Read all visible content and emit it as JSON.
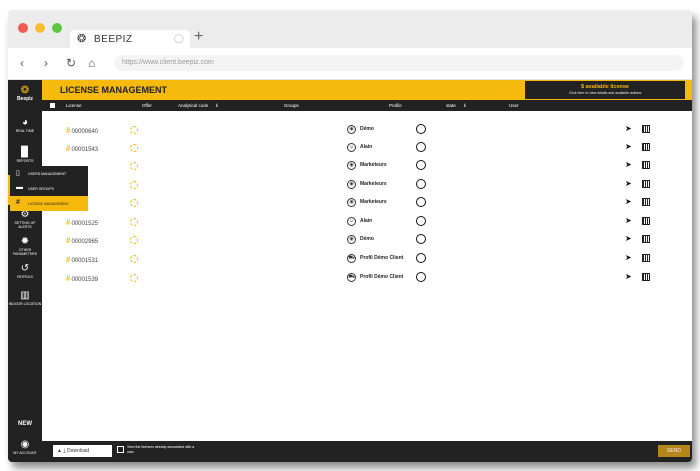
{
  "browser": {
    "tab_title": "BEEPIZ",
    "url": "https://www.client.beepiz.com"
  },
  "brand": {
    "name": "Beepiz"
  },
  "sidebar": {
    "items": [
      {
        "label": "Real time",
        "icon": "pie-chart-icon"
      },
      {
        "label": "Reports",
        "icon": "document-icon"
      },
      {
        "label": "Apps management",
        "icon": "phone-icon"
      },
      {
        "label": "Setting up alerts",
        "icon": "gears-icon"
      },
      {
        "label": "Other parameters",
        "icon": "gear-icon"
      },
      {
        "label": "Patrols",
        "icon": "patrol-icon"
      },
      {
        "label": "Indoor location",
        "icon": "building-icon"
      }
    ],
    "new_label": "NEW",
    "account_label": "MY ACCOUNT"
  },
  "submenu": {
    "items": [
      {
        "label": "Users management",
        "icon": "phone-icon"
      },
      {
        "label": "User groups",
        "icon": "folder-icon"
      },
      {
        "label": "License management",
        "icon": "hash-icon"
      }
    ]
  },
  "page": {
    "title": "LICENSE MANAGEMENT",
    "available_license": "$ available license",
    "available_hint": "Click here to view details and available actions"
  },
  "table": {
    "columns": [
      "License",
      "Offer",
      "Analytical code",
      "Groups",
      "Profile",
      "state",
      "User"
    ],
    "rows": [
      {
        "license": "00000640",
        "profile": "Démo",
        "profile_icon": "radio-icon"
      },
      {
        "license": "00001543",
        "profile": "Alain",
        "profile_icon": "user-icon"
      },
      {
        "license": "",
        "profile": "Marketeurs",
        "profile_icon": "radio-icon"
      },
      {
        "license": "",
        "profile": "Marketeurs",
        "profile_icon": "radio-icon"
      },
      {
        "license": "",
        "profile": "Marketeurs",
        "profile_icon": "radio-icon"
      },
      {
        "license": "00001525",
        "profile": "Alain",
        "profile_icon": "user-icon"
      },
      {
        "license": "00002965",
        "profile": "Démo",
        "profile_icon": "radio-icon"
      },
      {
        "license": "00001531",
        "profile": "Profil Démo Client",
        "profile_icon": "car-icon"
      },
      {
        "license": "00001539",
        "profile": "Profil Démo Client",
        "profile_icon": "car-icon"
      }
    ]
  },
  "footer": {
    "download_label": "Download",
    "view_label": "View the licences already associated with a user",
    "send_label": "SEND"
  },
  "colors": {
    "accent": "#f6b90e",
    "dark": "#222222"
  }
}
